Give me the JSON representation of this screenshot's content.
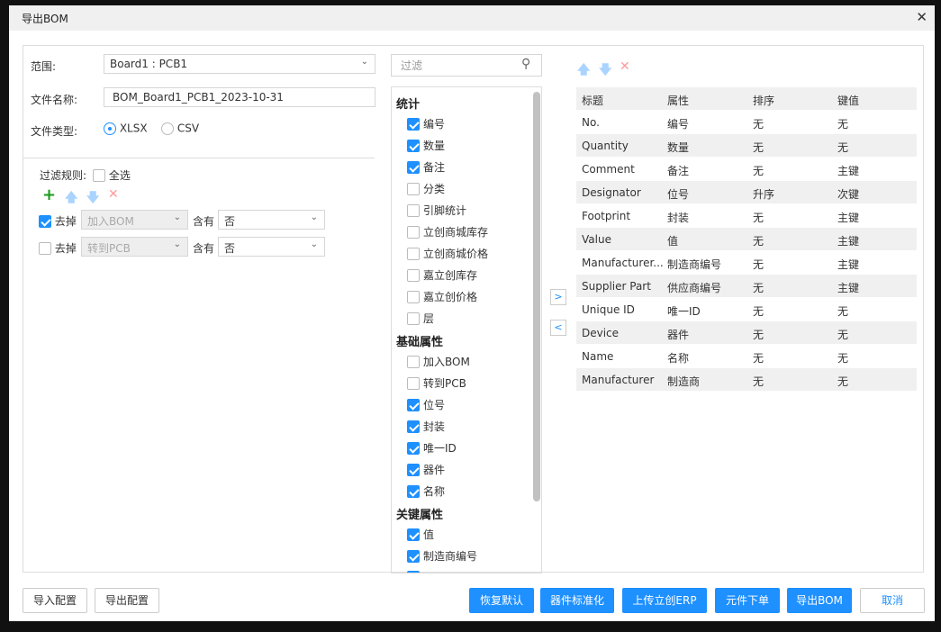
{
  "window": {
    "title": "导出BOM",
    "close": "✕"
  },
  "left": {
    "range_label": "范围:",
    "range_value": "Board1 : PCB1",
    "filename_label": "文件名称:",
    "filename_value": "BOM_Board1_PCB1_2023-10-31",
    "filetype_label": "文件类型:",
    "filetype_options": [
      "XLSX",
      "CSV"
    ],
    "filetype_selected": "XLSX",
    "filter_label": "过滤规则:",
    "select_all": "全选",
    "select_all_checked": false,
    "rules": [
      {
        "checked": true,
        "action": "去掉",
        "field": "加入BOM",
        "op": "含有",
        "value": "否"
      },
      {
        "checked": false,
        "action": "去掉",
        "field": "转到PCB",
        "op": "含有",
        "value": "否"
      }
    ]
  },
  "middle": {
    "filter_placeholder": "过滤",
    "groups": [
      {
        "name": "统计",
        "items": [
          {
            "label": "编号",
            "checked": true
          },
          {
            "label": "数量",
            "checked": true
          },
          {
            "label": "备注",
            "checked": true
          },
          {
            "label": "分类",
            "checked": false
          },
          {
            "label": "引脚统计",
            "checked": false
          },
          {
            "label": "立创商城库存",
            "checked": false
          },
          {
            "label": "立创商城价格",
            "checked": false
          },
          {
            "label": "嘉立创库存",
            "checked": false
          },
          {
            "label": "嘉立创价格",
            "checked": false
          },
          {
            "label": "层",
            "checked": false
          }
        ]
      },
      {
        "name": "基础属性",
        "items": [
          {
            "label": "加入BOM",
            "checked": false
          },
          {
            "label": "转到PCB",
            "checked": false
          },
          {
            "label": "位号",
            "checked": true
          },
          {
            "label": "封装",
            "checked": true
          },
          {
            "label": "唯一ID",
            "checked": true
          },
          {
            "label": "器件",
            "checked": true
          },
          {
            "label": "名称",
            "checked": true
          }
        ]
      },
      {
        "name": "关键属性",
        "items": [
          {
            "label": "值",
            "checked": true
          },
          {
            "label": "制造商编号",
            "checked": true
          }
        ]
      }
    ],
    "move_right": ">",
    "move_left": "<"
  },
  "table": {
    "headers": [
      "标题",
      "属性",
      "排序",
      "键值"
    ],
    "rows": [
      [
        "No.",
        "编号",
        "无",
        "无"
      ],
      [
        "Quantity",
        "数量",
        "无",
        "无"
      ],
      [
        "Comment",
        "备注",
        "无",
        "主键"
      ],
      [
        "Designator",
        "位号",
        "升序",
        "次键"
      ],
      [
        "Footprint",
        "封装",
        "无",
        "主键"
      ],
      [
        "Value",
        "值",
        "无",
        "主键"
      ],
      [
        "Manufacturer...",
        "制造商编号",
        "无",
        "主键"
      ],
      [
        "Supplier Part",
        "供应商编号",
        "无",
        "主键"
      ],
      [
        "Unique ID",
        "唯一ID",
        "无",
        "无"
      ],
      [
        "Device",
        "器件",
        "无",
        "无"
      ],
      [
        "Name",
        "名称",
        "无",
        "无"
      ],
      [
        "Manufacturer",
        "制造商",
        "无",
        "无"
      ]
    ]
  },
  "footer": {
    "import_config": "导入配置",
    "export_config": "导出配置",
    "restore_default": "恢复默认",
    "standardize": "器件标准化",
    "upload_erp": "上传立创ERP",
    "order": "元件下单",
    "export_bom": "导出BOM",
    "cancel": "取消"
  },
  "colors": {
    "accent": "#1e90ff",
    "add": "#1a9a1a",
    "delete": "#ff8a8a"
  }
}
